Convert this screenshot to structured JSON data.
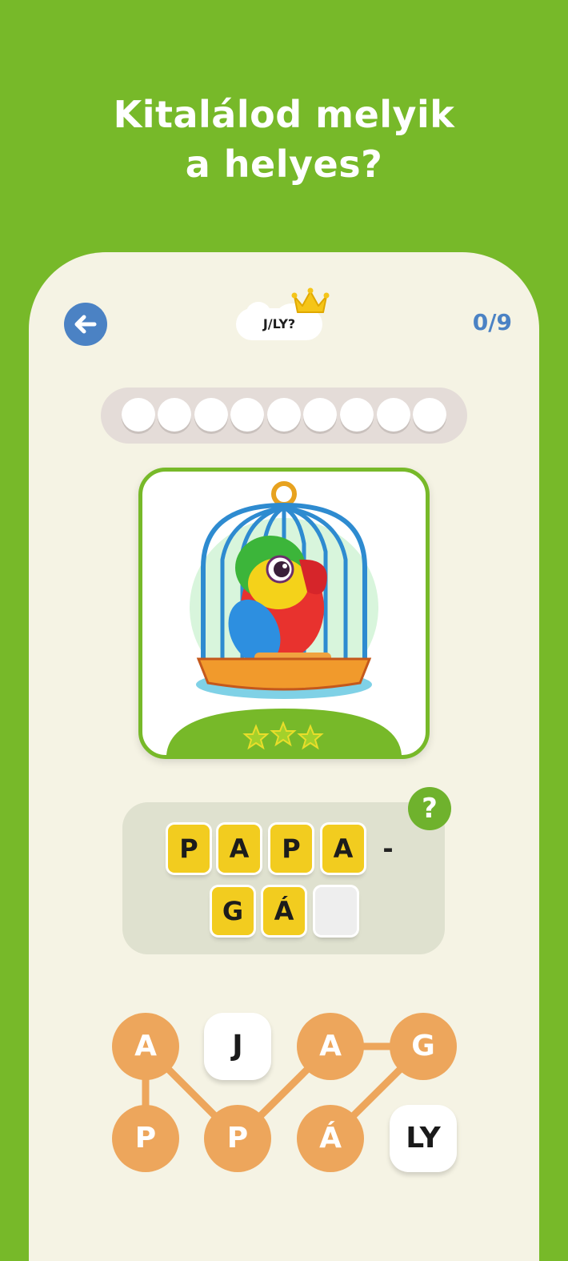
{
  "headline": {
    "line1": "Kitalálod melyik",
    "line2": "a helyes?"
  },
  "header": {
    "badge_label": "J/LY?",
    "counter": "0/9",
    "back_icon": "arrow-left-icon",
    "crown_icon": "crown-icon"
  },
  "progress": {
    "total": 9,
    "completed": 0
  },
  "picture": {
    "subject": "parrot-in-cage",
    "stars_earned": 0,
    "stars_total": 3
  },
  "word": {
    "syllable1": [
      "P",
      "A",
      "P",
      "A"
    ],
    "hyphen": "-",
    "syllable2": [
      "G",
      "Á",
      ""
    ]
  },
  "hint": {
    "label": "?"
  },
  "letters": {
    "row1": [
      "A",
      "J",
      "A",
      "G"
    ],
    "row2": [
      "P",
      "P",
      "Á",
      "LY"
    ]
  },
  "colors": {
    "background": "#77b929",
    "panel": "#f5f3e4",
    "accent_blue": "#4b82c4",
    "tile_yellow": "#f2cc1f",
    "letter_orange": "#eda65c"
  }
}
